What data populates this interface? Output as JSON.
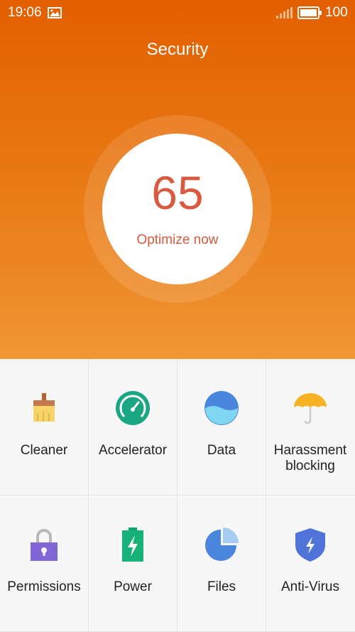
{
  "status_bar": {
    "time": "19:06",
    "battery": "100",
    "image_icon": "image-icon",
    "signal_icon": "signal-icon",
    "battery_icon": "battery-icon"
  },
  "header": {
    "title": "Security",
    "score": "65",
    "action": "Optimize now",
    "colors": {
      "gradient_top": "#e35f00",
      "gradient_bottom": "#f09536",
      "score_text": "#d95a3f"
    }
  },
  "tools": [
    {
      "label": "Cleaner",
      "icon": "broom-icon"
    },
    {
      "label": "Accelerator",
      "icon": "speedometer-icon"
    },
    {
      "label": "Data",
      "icon": "data-globe-icon"
    },
    {
      "label": "Harassment blocking",
      "icon": "umbrella-icon"
    },
    {
      "label": "Permissions",
      "icon": "lock-icon"
    },
    {
      "label": "Power",
      "icon": "battery-bolt-icon"
    },
    {
      "label": "Files",
      "icon": "pie-chart-icon"
    },
    {
      "label": "Anti-Virus",
      "icon": "shield-bolt-icon"
    }
  ]
}
